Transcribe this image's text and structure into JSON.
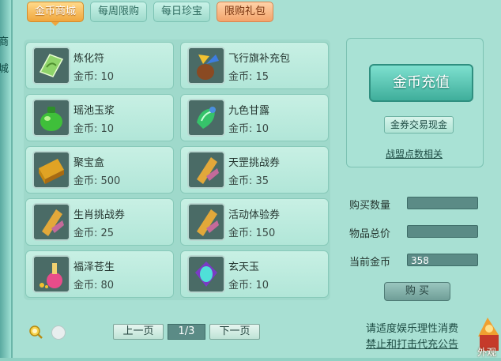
{
  "side_labels": [
    "商",
    "城"
  ],
  "tabs": [
    {
      "label": "金币商城",
      "active": true
    },
    {
      "label": "每周限购",
      "active": false
    },
    {
      "label": "每日珍宝",
      "active": false
    },
    {
      "label": "限购礼包",
      "active": false
    }
  ],
  "items": [
    {
      "name": "炼化符",
      "price": "金币: 10",
      "icon": "talisman-icon"
    },
    {
      "name": "飞行旗补充包",
      "price": "金币: 15",
      "icon": "flag-bag-icon"
    },
    {
      "name": "瑶池玉浆",
      "price": "金币: 10",
      "icon": "green-jar-icon"
    },
    {
      "name": "九色甘露",
      "price": "金币: 10",
      "icon": "green-gem-icon"
    },
    {
      "name": "聚宝盒",
      "price": "金币: 500",
      "icon": "gold-box-icon"
    },
    {
      "name": "天罡挑战券",
      "price": "金币: 35",
      "icon": "scroll-icon"
    },
    {
      "name": "生肖挑战券",
      "price": "金币: 25",
      "icon": "scroll-icon"
    },
    {
      "name": "活动体验券",
      "price": "金币: 150",
      "icon": "scroll-icon"
    },
    {
      "name": "福泽苍生",
      "price": "金币: 80",
      "icon": "potion-icon"
    },
    {
      "name": "玄天玉",
      "price": "金币: 10",
      "icon": "jade-icon"
    }
  ],
  "right_panel": {
    "recharge_label": "金币充值",
    "exchange_label": "金券交易现金",
    "alliance_link": "战盟点数相关"
  },
  "purchase": {
    "quantity_label": "购买数量",
    "quantity_value": "",
    "total_label": "物品总价",
    "total_value": "",
    "current_gold_label": "当前金币",
    "current_gold_value": "358",
    "buy_label": "购 买"
  },
  "pager": {
    "prev_label": "上一页",
    "page_info": "1/3",
    "next_label": "下一页"
  },
  "notices": {
    "line1": "请适度娱乐理性消费",
    "line2": "禁止和打击代充公告"
  },
  "outlook_label": "外观",
  "colors": {
    "active_tab": "#f0a63c",
    "panel_bg": "#a8e0d3",
    "recharge_button": "#3fae9b"
  }
}
